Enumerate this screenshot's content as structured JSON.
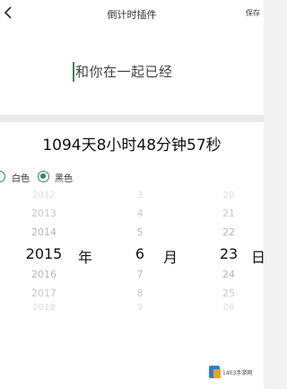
{
  "header": {
    "title": "倒计时插件",
    "save_label": "保存"
  },
  "input": {
    "value": "和你在一起已经"
  },
  "result": {
    "countdown": "1094天8小时48分钟57秒"
  },
  "theme_options": [
    {
      "label": "白色",
      "selected": false
    },
    {
      "label": "黑色",
      "selected": true
    }
  ],
  "picker": {
    "years": [
      "2012",
      "2013",
      "2014",
      "2015",
      "2016",
      "2017",
      "2018"
    ],
    "months": [
      "3",
      "4",
      "5",
      "6",
      "7",
      "8",
      "9"
    ],
    "days": [
      "20",
      "21",
      "22",
      "23",
      "24",
      "25",
      "26"
    ],
    "selected_year": "2015",
    "selected_month": "6",
    "selected_day": "23",
    "unit_year": "年",
    "unit_month": "月",
    "unit_day": "日"
  },
  "watermark": {
    "text": "1403手游网"
  },
  "colors": {
    "accent": "#2e8b57"
  }
}
